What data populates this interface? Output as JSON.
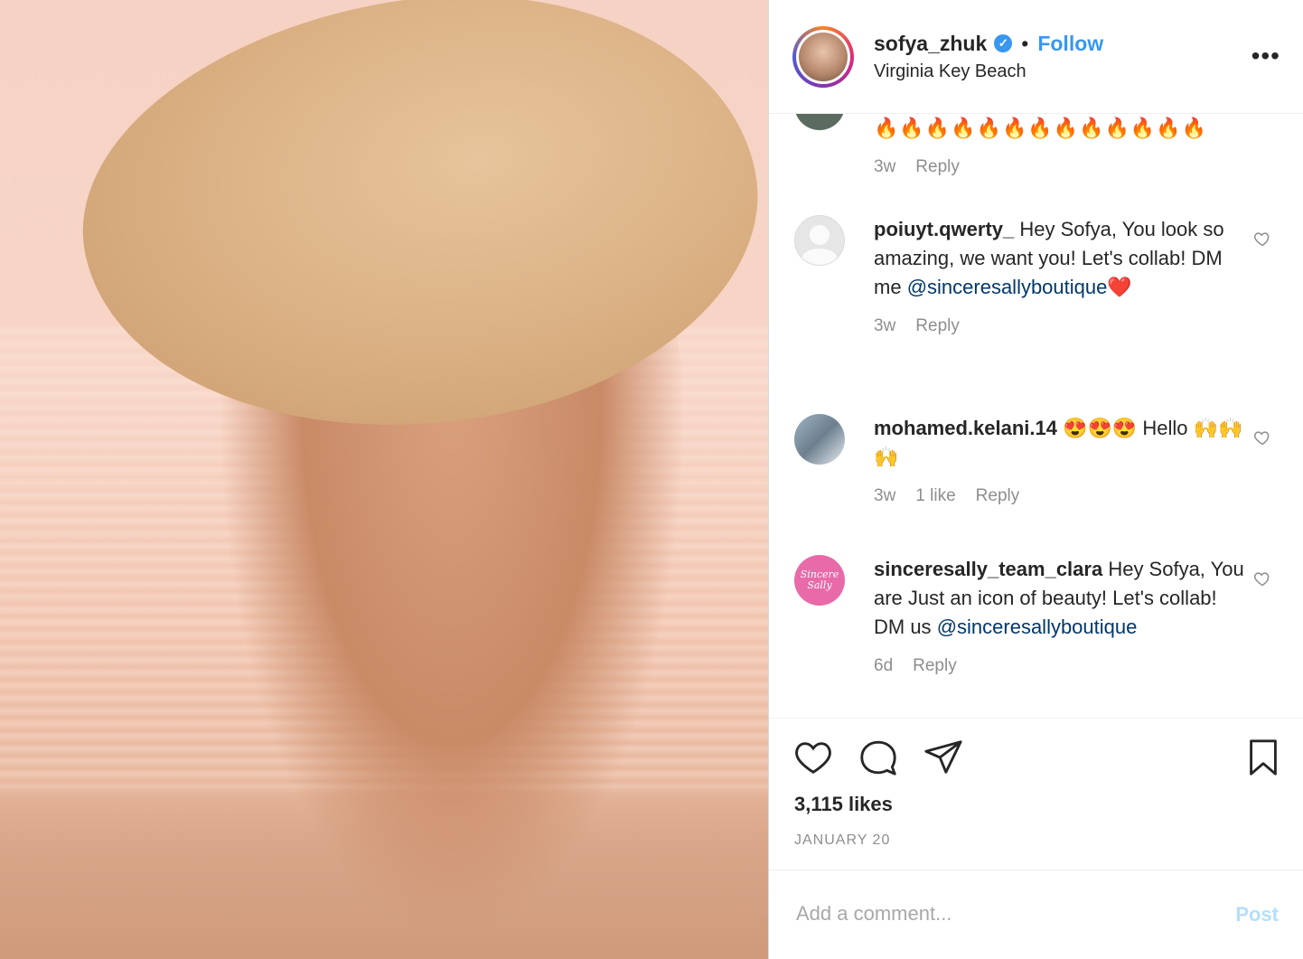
{
  "header": {
    "username": "sofya_zhuk",
    "verified_mark": "✓",
    "separator": "•",
    "follow_label": "Follow",
    "location": "Virginia Key Beach",
    "more_label": "•••"
  },
  "comments": [
    {
      "username": "",
      "text": "🔥🔥🔥🔥🔥🔥🔥🔥🔥🔥🔥🔥🔥",
      "time": "3w",
      "likes": "",
      "reply": "Reply"
    },
    {
      "username": "poiuyt.qwerty_",
      "text": " Hey Sofya, You look so amazing, we want you! Let's collab! DM me ",
      "mention": "@sinceresallyboutique",
      "tail": "❤️",
      "time": "3w",
      "likes": "",
      "reply": "Reply"
    },
    {
      "username": "mohamed.kelani.14",
      "text": " 😍😍😍 Hello 🙌🙌🙌",
      "time": "3w",
      "likes": "1 like",
      "reply": "Reply"
    },
    {
      "username": "sinceresally_team_clara",
      "text": " Hey Sofya, You are Just an icon of beauty! Let's collab! DM us ",
      "mention": "@sinceresallyboutique",
      "time": "6d",
      "likes": "",
      "reply": "Reply",
      "avatar_text": "Sincere Sally"
    }
  ],
  "actions": {
    "likes": "3,115 likes",
    "date": "JANUARY 20"
  },
  "add_comment": {
    "placeholder": "Add a comment...",
    "post_label": "Post"
  },
  "colors": {
    "accent": "#3897f0",
    "post_disabled": "#b2dffc",
    "muted": "#8e8e8e"
  }
}
